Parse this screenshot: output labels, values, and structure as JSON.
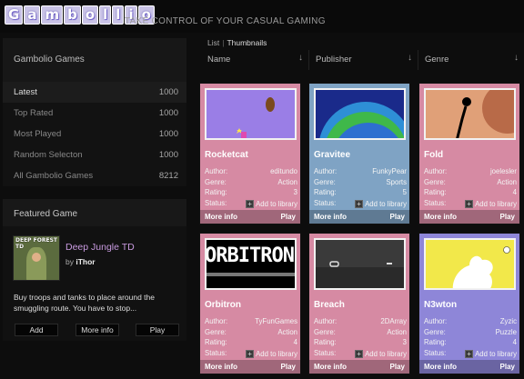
{
  "header": {
    "logo_letters": [
      "G",
      "a",
      "m",
      "b",
      "o",
      "l",
      "l",
      "i",
      "o"
    ],
    "tagline": "TAKE CONTROL OF YOUR CASUAL GAMING"
  },
  "sidebar": {
    "title": "Gambolio Games",
    "items": [
      {
        "label": "Latest",
        "count": "1000"
      },
      {
        "label": "Top Rated",
        "count": "1000"
      },
      {
        "label": "Most Played",
        "count": "1000"
      },
      {
        "label": "Random Selecton",
        "count": "1000"
      },
      {
        "label": "All Gambolio Games",
        "count": "8212"
      }
    ]
  },
  "featured": {
    "heading": "Featured Game",
    "thumb_text": "DEEP FOREST TD",
    "title": "Deep Jungle TD",
    "by_prefix": "by",
    "author": "iThor",
    "description": "Buy troops and tanks to place around the smuggling route. You have to stop...",
    "add_label": "Add",
    "info_label": "More info",
    "play_label": "Play"
  },
  "view": {
    "list": "List",
    "separator": "|",
    "thumbnails": "Thumbnails"
  },
  "columns": {
    "name": "Name",
    "publisher": "Publisher",
    "genre": "Genre",
    "sort_icon": "down-arrow-icon"
  },
  "labels": {
    "author": "Author:",
    "genre": "Genre:",
    "rating": "Rating:",
    "status": "Status:",
    "add_library": "Add to library",
    "more_info": "More info",
    "play": "Play"
  },
  "games": [
    {
      "title": "Rocketcat",
      "author": "editundo",
      "genre": "Action",
      "rating": "3",
      "color": "#d68aa3"
    },
    {
      "title": "Gravitee",
      "author": "FunkyPear",
      "genre": "Sports",
      "rating": "5",
      "color": "#7fa3c4"
    },
    {
      "title": "Fold",
      "author": "joelesler",
      "genre": "Action",
      "rating": "4",
      "color": "#d68aa3"
    },
    {
      "title": "Orbitron",
      "author": "TyFunGames",
      "genre": "Action",
      "rating": "4",
      "color": "#d68aa3"
    },
    {
      "title": "Breach",
      "author": "2DArray",
      "genre": "Action",
      "rating": "3",
      "color": "#d68aa3"
    },
    {
      "title": "N3wton",
      "author": "Zyzic",
      "genre": "Puzzle",
      "rating": "4",
      "color": "#8e86d8"
    }
  ],
  "screenshot_text": {
    "orbitron": "ORBITRON"
  }
}
